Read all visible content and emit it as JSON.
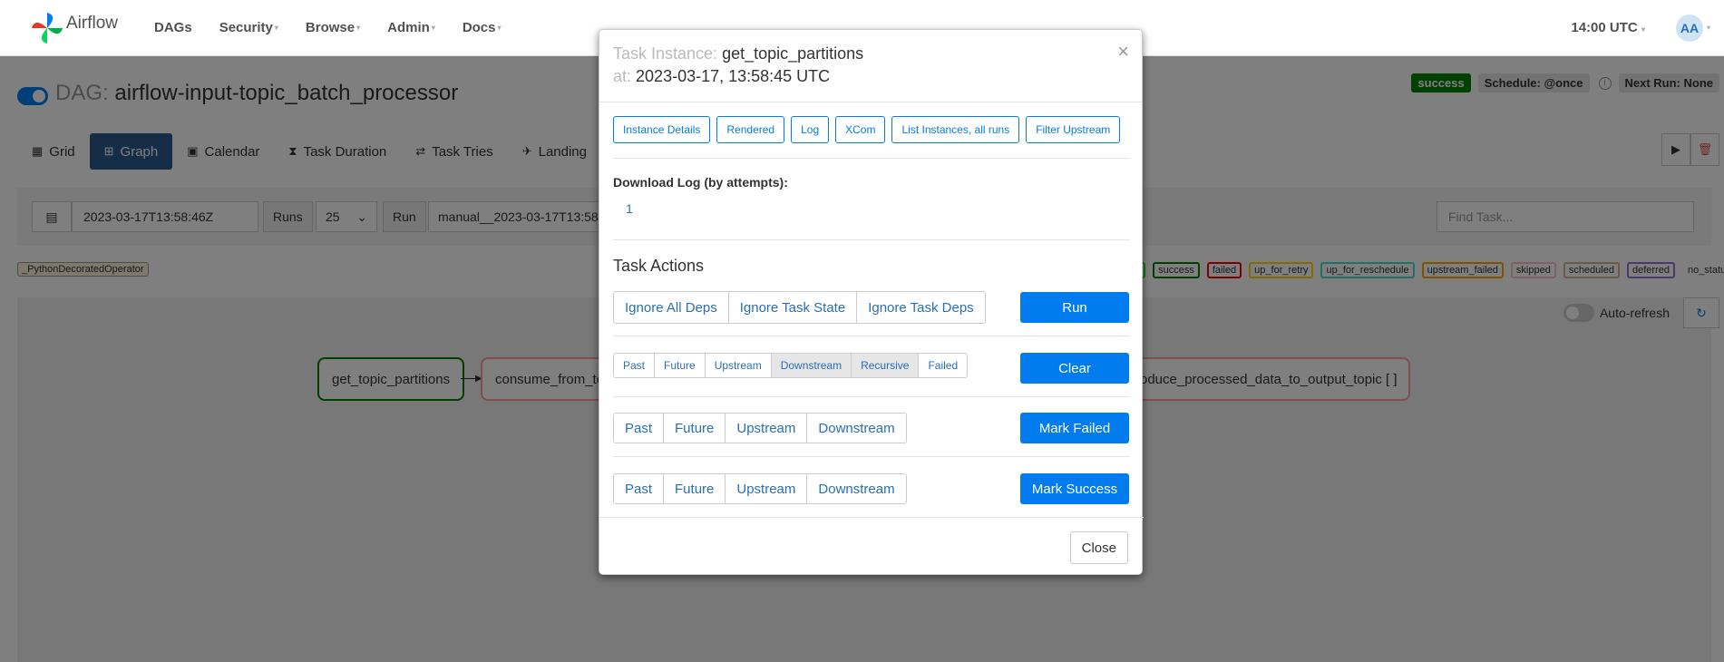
{
  "nav": {
    "brand": "Airflow",
    "items": [
      {
        "label": "DAGs",
        "caret": false
      },
      {
        "label": "Security",
        "caret": true
      },
      {
        "label": "Browse",
        "caret": true
      },
      {
        "label": "Admin",
        "caret": true
      },
      {
        "label": "Docs",
        "caret": true
      }
    ],
    "time": "14:00 UTC",
    "avatar": "AA"
  },
  "dag": {
    "label": "DAG:",
    "name": "airflow-input-topic_batch_processor",
    "status": "success",
    "schedule": "Schedule: @once",
    "next_run": "Next Run: None"
  },
  "view_tabs": [
    "Grid",
    "Graph",
    "Calendar",
    "Task Duration",
    "Task Tries",
    "Landing"
  ],
  "filters": {
    "date": "2023-03-17T13:58:46Z",
    "runs_label": "Runs",
    "runs_value": "25",
    "run_label": "Run",
    "run_value": "manual__2023-03-17T13:58",
    "find_placeholder": "Find Task..."
  },
  "operator_legend": "_PythonDecoratedOperator",
  "state_legend": [
    {
      "label": "g",
      "color": "#00ff00"
    },
    {
      "label": "success",
      "color": "#008000"
    },
    {
      "label": "failed",
      "color": "#ff0000"
    },
    {
      "label": "up_for_retry",
      "color": "#ffd700"
    },
    {
      "label": "up_for_reschedule",
      "color": "#40e0d0"
    },
    {
      "label": "upstream_failed",
      "color": "#ffa500"
    },
    {
      "label": "skipped",
      "color": "#ffc0cb"
    },
    {
      "label": "scheduled",
      "color": "#d2b48c"
    },
    {
      "label": "deferred",
      "color": "#9370db"
    },
    {
      "label": "no_status",
      "color": "transparent"
    }
  ],
  "auto_refresh": "Auto-refresh",
  "graph_nodes": [
    {
      "label": "get_topic_partitions",
      "color": "#008000"
    },
    {
      "label": "consume_from_to",
      "color": "#ff9f9f"
    },
    {
      "label": "roduce_processed_data_to_output_topic [ ]",
      "color": "#ff9f9f"
    }
  ],
  "modal": {
    "title_label": "Task Instance:",
    "title_value": "get_topic_partitions",
    "at_label": "at:",
    "at_value": "2023-03-17, 13:58:45 UTC",
    "close_x": "×",
    "top_buttons": [
      "Instance Details",
      "Rendered",
      "Log",
      "XCom",
      "List Instances, all runs",
      "Filter Upstream"
    ],
    "download_title": "Download Log (by attempts):",
    "download_attempts": [
      "1"
    ],
    "task_actions_title": "Task Actions",
    "run_group": [
      "Ignore All Deps",
      "Ignore Task State",
      "Ignore Task Deps"
    ],
    "run_button": "Run",
    "clear_group": [
      "Past",
      "Future",
      "Upstream",
      "Downstream",
      "Recursive",
      "Failed"
    ],
    "clear_button": "Clear",
    "failed_group": [
      "Past",
      "Future",
      "Upstream",
      "Downstream"
    ],
    "failed_button": "Mark Failed",
    "success_group": [
      "Past",
      "Future",
      "Upstream",
      "Downstream"
    ],
    "success_button": "Mark Success",
    "footer_close": "Close"
  }
}
